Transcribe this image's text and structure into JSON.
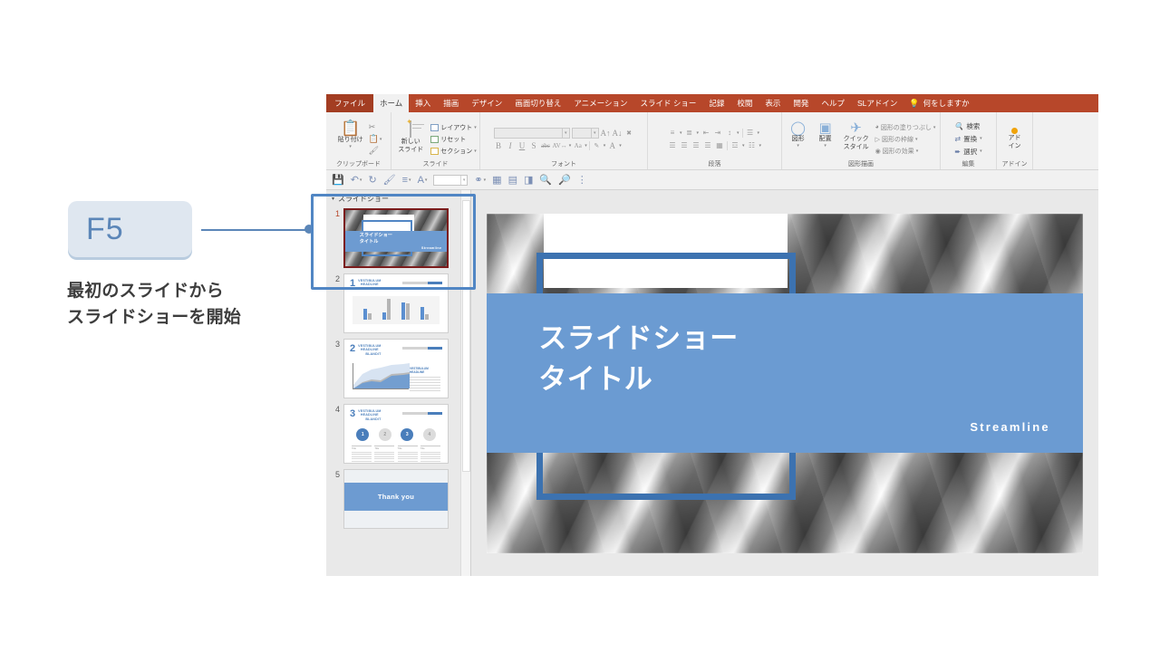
{
  "annotation": {
    "key_label": "F5",
    "caption_line1": "最初のスライドから",
    "caption_line2": "スライドショーを開始",
    "accent_color": "#5b86b8",
    "badge_bg": "#dfe7f0"
  },
  "ribbon": {
    "tabs": [
      {
        "label": "ファイル",
        "state": "file"
      },
      {
        "label": "ホーム",
        "state": "active"
      },
      {
        "label": "挿入",
        "state": "normal"
      },
      {
        "label": "描画",
        "state": "normal"
      },
      {
        "label": "デザイン",
        "state": "normal"
      },
      {
        "label": "画面切り替え",
        "state": "normal"
      },
      {
        "label": "アニメーション",
        "state": "normal"
      },
      {
        "label": "スライド ショー",
        "state": "normal"
      },
      {
        "label": "記録",
        "state": "normal"
      },
      {
        "label": "校閲",
        "state": "normal"
      },
      {
        "label": "表示",
        "state": "normal"
      },
      {
        "label": "開発",
        "state": "normal"
      },
      {
        "label": "ヘルプ",
        "state": "normal"
      },
      {
        "label": "SLアドイン",
        "state": "normal"
      }
    ],
    "tell_me": "何をしますか",
    "tab_bar_color": "#b7472a",
    "groups": {
      "clipboard": {
        "title": "クリップボード",
        "paste_label": "貼り付け",
        "items": [
          "cut-icon",
          "copy-icon",
          "format-painter-icon"
        ]
      },
      "slide": {
        "title": "スライド",
        "new_slide_label": "新しい\nスライド",
        "new_slide_label_line1": "新しい",
        "new_slide_label_line2": "スライド",
        "layout_label": "レイアウト",
        "reset_label": "リセット",
        "section_label": "セクション"
      },
      "font": {
        "title": "フォント",
        "font_name_value": "",
        "font_size_value": "",
        "buttons": [
          "B",
          "I",
          "U",
          "S",
          "abc",
          "AV",
          "Aa"
        ]
      },
      "paragraph": {
        "title": "段落"
      },
      "drawing": {
        "title": "図形描画",
        "shapes_label": "図形",
        "arrange_label": "配置",
        "quick_styles_label_line1": "クイック",
        "quick_styles_label_line2": "スタイル",
        "fill_label": "図形の塗りつぶし",
        "outline_label": "図形の枠線",
        "effects_label": "図形の効果"
      },
      "editing": {
        "title": "編集",
        "find_label": "検索",
        "replace_label": "置換",
        "select_label": "選択"
      },
      "addin": {
        "title": "アドイン",
        "label_line1": "アド",
        "label_line2": "イン"
      }
    }
  },
  "quick_access": {
    "icons": [
      "save-icon",
      "undo-icon",
      "redo-icon",
      "format-painter-icon",
      "bullets-icon",
      "font-color-icon",
      "shape-fill-icon",
      "shape-icon",
      "align-icon",
      "text-box-icon",
      "crop-icon",
      "zoom-in-icon",
      "zoom-out-icon",
      "overflow-icon"
    ],
    "combo_value": ""
  },
  "thumbnail_pane": {
    "section_title": "スライドショー",
    "selected_index": 1,
    "slides": [
      {
        "number": "1",
        "type": "title",
        "title_line1": "スライドショー",
        "title_line2": "タイトル",
        "brand": "Streamline",
        "selected": true
      },
      {
        "number": "2",
        "type": "bar-chart",
        "big_number": "1",
        "heading_line1": "VESTIBULUM",
        "heading_line2": "HEADLINE",
        "heading_line3": "BLANDIT",
        "bars": [
          {
            "blue": 38,
            "gray": 22
          },
          {
            "blue": 26,
            "gray": 72
          },
          {
            "blue": 58,
            "gray": 56
          },
          {
            "blue": 44,
            "gray": 20
          }
        ]
      },
      {
        "number": "3",
        "type": "area-chart",
        "big_number": "2",
        "heading_line1": "VESTIBULUM",
        "heading_line2": "HEADLINE",
        "heading_line3": "BLANDIT",
        "side_title_line1": "VESTIBULUM",
        "side_title_line2": "HEADLINE"
      },
      {
        "number": "4",
        "type": "steps",
        "big_number": "3",
        "heading_line1": "VESTIBULUM",
        "heading_line2": "HEADLINE",
        "heading_line3": "BLANDIT",
        "steps": [
          {
            "label": "1",
            "active": true,
            "title": "Title"
          },
          {
            "label": "2",
            "active": false,
            "title": "Title"
          },
          {
            "label": "3",
            "active": true,
            "title": "Title"
          },
          {
            "label": "4",
            "active": false,
            "title": "Title"
          }
        ]
      },
      {
        "number": "5",
        "type": "closing",
        "text": "Thank you"
      }
    ]
  },
  "slide_canvas": {
    "title_line1": "スライドショー",
    "title_line2": "タイトル",
    "brand": "Streamline",
    "band_color": "#6b9bd2",
    "frame_color": "#3c72b0"
  }
}
